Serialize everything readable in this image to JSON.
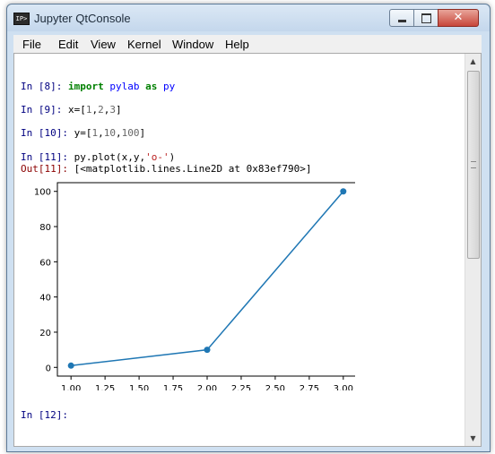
{
  "window": {
    "title": "Jupyter QtConsole",
    "icon_glyph": "IP>",
    "close_glyph": "✕"
  },
  "menu": [
    "File",
    "Edit",
    "View",
    "Kernel",
    "Window",
    "Help"
  ],
  "cells": [
    {
      "prompt": "In [8]:",
      "parts": [
        [
          "kw",
          "import"
        ],
        [
          "txt",
          " "
        ],
        [
          "nm",
          "pylab"
        ],
        [
          "txt",
          " "
        ],
        [
          "kw",
          "as"
        ],
        [
          "txt",
          " "
        ],
        [
          "nm",
          "py"
        ]
      ]
    },
    {
      "prompt": "In [9]:",
      "parts": [
        [
          "txt",
          "x=["
        ],
        [
          "num",
          "1"
        ],
        [
          "txt",
          ","
        ],
        [
          "num",
          "2"
        ],
        [
          "txt",
          ","
        ],
        [
          "num",
          "3"
        ],
        [
          "txt",
          "]"
        ]
      ]
    },
    {
      "prompt": "In [10]:",
      "parts": [
        [
          "txt",
          "y=["
        ],
        [
          "num",
          "1"
        ],
        [
          "txt",
          ","
        ],
        [
          "num",
          "10"
        ],
        [
          "txt",
          ","
        ],
        [
          "num",
          "100"
        ],
        [
          "txt",
          "]"
        ]
      ]
    },
    {
      "prompt": "In [11]:",
      "parts": [
        [
          "txt",
          "py.plot(x,y,"
        ],
        [
          "str",
          "'o-'"
        ],
        [
          "txt",
          ")"
        ]
      ]
    }
  ],
  "output": {
    "prompt": "Out[11]:",
    "text": "[<matplotlib.lines.Line2D at 0x83ef790>]"
  },
  "next_prompt": "In [12]:",
  "colors": {
    "line": "#1f77b4"
  },
  "chart_data": {
    "type": "line",
    "x": [
      1,
      2,
      3
    ],
    "y": [
      1,
      10,
      100
    ],
    "marker": "o",
    "xlim": [
      0.9,
      3.1
    ],
    "ylim": [
      -4.95,
      104.95
    ],
    "xticks": [
      "1.00",
      "1.25",
      "1.50",
      "1.75",
      "2.00",
      "2.25",
      "2.50",
      "2.75",
      "3.00"
    ],
    "yticks": [
      "0",
      "20",
      "40",
      "60",
      "80",
      "100"
    ],
    "grid": false
  }
}
